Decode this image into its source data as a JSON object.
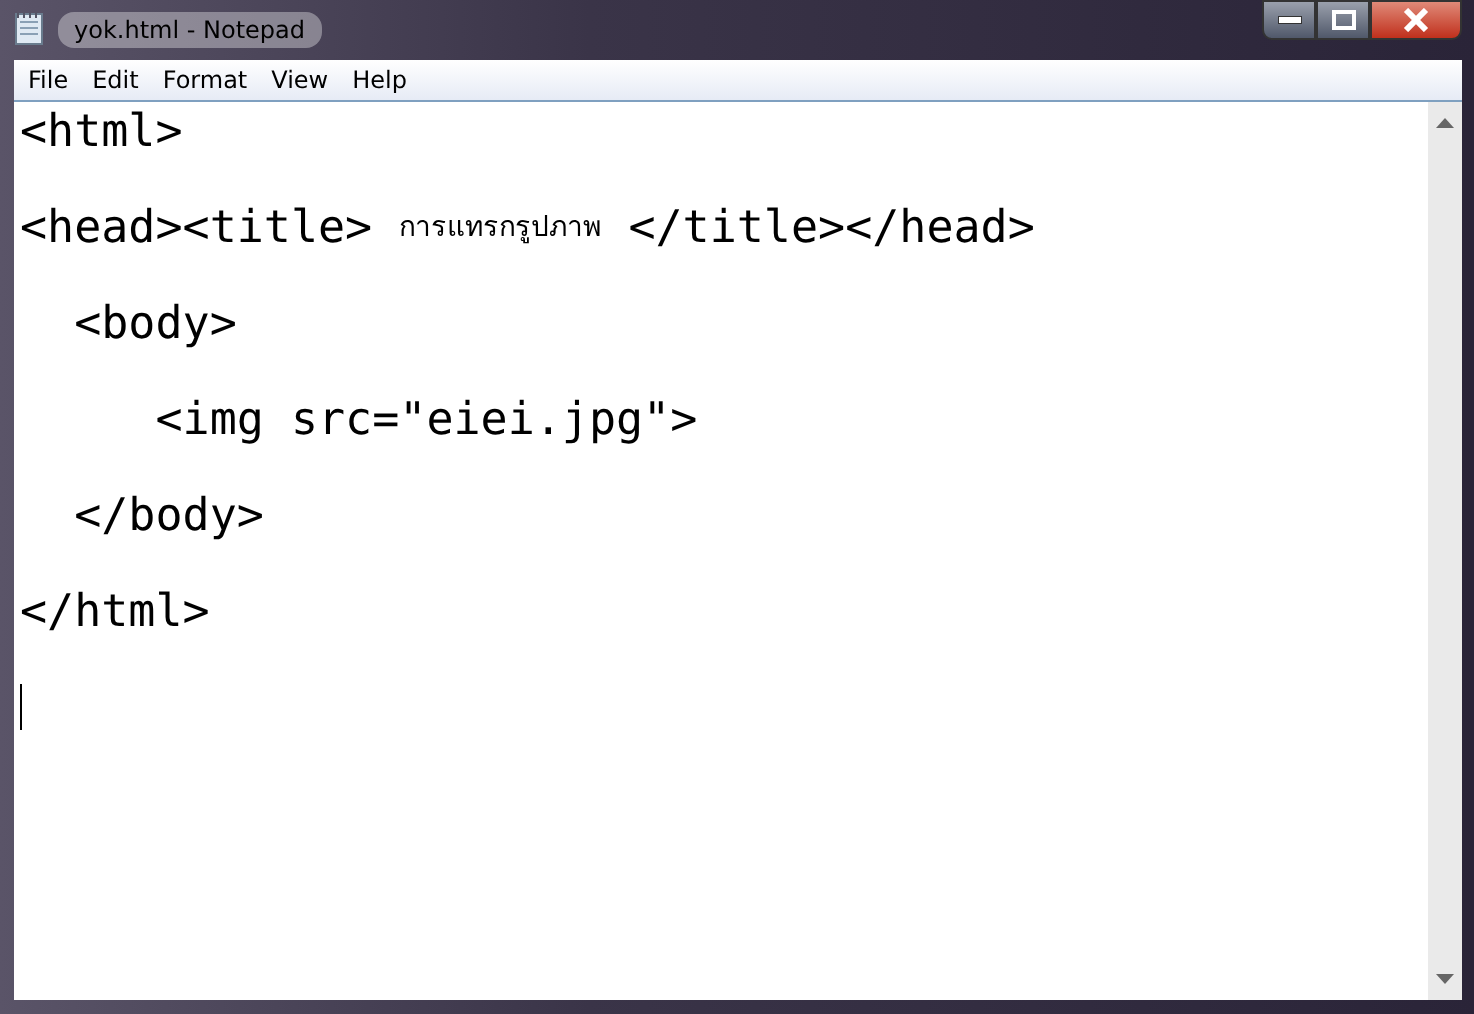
{
  "window": {
    "title": "yok.html - Notepad"
  },
  "menu": [
    "File",
    "Edit",
    "Format",
    "View",
    "Help"
  ],
  "editor": {
    "lines": [
      {
        "caret": false,
        "segments": [
          {
            "kind": "code",
            "text": "<html>"
          }
        ]
      },
      {
        "caret": false,
        "segments": [
          {
            "kind": "code",
            "text": "<head><title> "
          },
          {
            "kind": "small",
            "text": "การแทรกรูปภาพ"
          },
          {
            "kind": "code",
            "text": " </title></head>"
          }
        ]
      },
      {
        "caret": false,
        "segments": [
          {
            "kind": "code",
            "text": "  <body>"
          }
        ]
      },
      {
        "caret": false,
        "segments": [
          {
            "kind": "code",
            "text": "     <img src=\"eiei.jpg\">"
          }
        ]
      },
      {
        "caret": false,
        "segments": [
          {
            "kind": "code",
            "text": "  </body>"
          }
        ]
      },
      {
        "caret": false,
        "segments": [
          {
            "kind": "code",
            "text": "</html>"
          }
        ]
      },
      {
        "caret": true
      }
    ]
  }
}
